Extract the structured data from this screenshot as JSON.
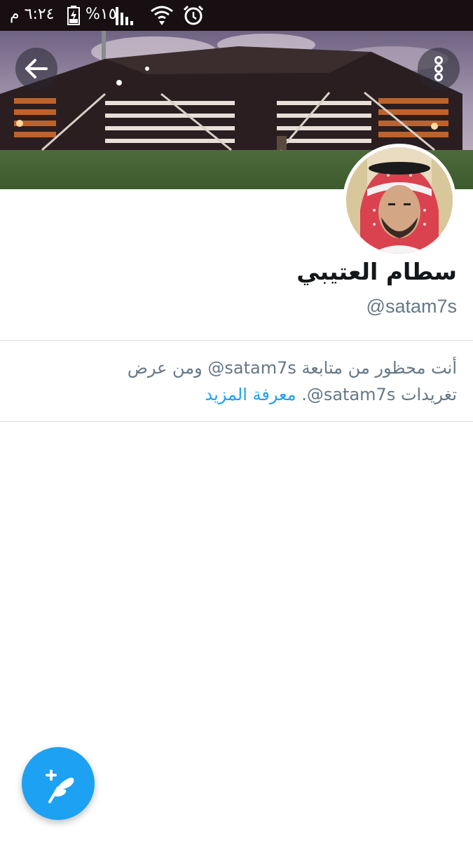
{
  "status_bar": {
    "time": "٦:٢٤ م",
    "battery_percent": "%١٥",
    "icons": [
      "battery-icon",
      "signal-icon",
      "wifi-icon",
      "alarm-icon"
    ]
  },
  "header": {
    "back_icon": "arrow-left-icon",
    "more_icon": "more-vertical-icon",
    "banner": "tent-banner-photo"
  },
  "profile": {
    "display_name": "سطام العتيبي",
    "handle": "@satam7s",
    "avatar": "profile-photo"
  },
  "blocked_notice": {
    "text": "أنت محظور من متابعة satam7s@ ومن عرض تغريدات satam7s@.",
    "learn_more": "معرفة المزيد"
  },
  "fab": {
    "icon": "compose-tweet-icon"
  },
  "colors": {
    "accent": "#1da1f2",
    "status_bar": "#170f12",
    "name_text": "#14171a",
    "secondary_text": "#657786",
    "divider": "#d6dde2"
  }
}
